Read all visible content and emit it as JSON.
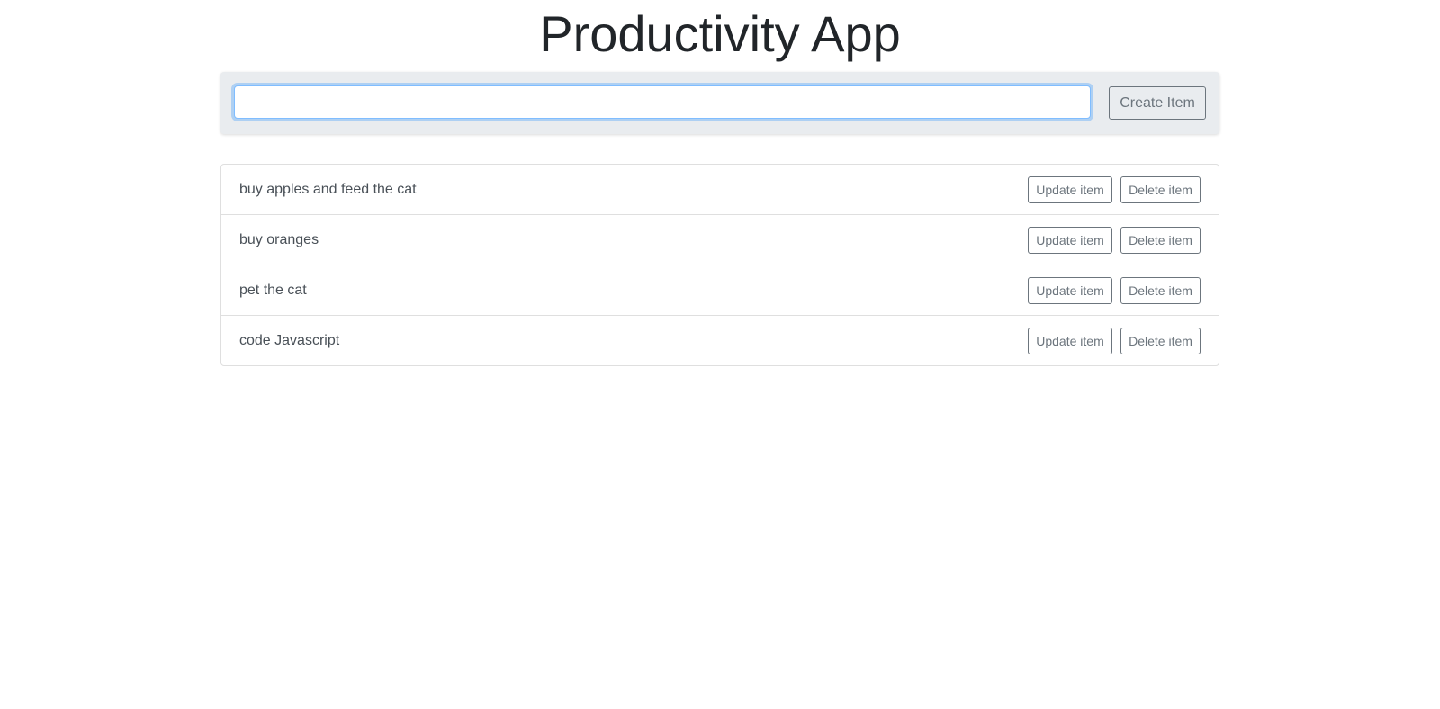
{
  "header": {
    "title": "Productivity App"
  },
  "create_form": {
    "input_value": "",
    "create_button_label": "Create Item"
  },
  "items": [
    {
      "text": "buy apples and feed the cat",
      "update_label": "Update item",
      "delete_label": "Delete item"
    },
    {
      "text": "buy oranges",
      "update_label": "Update item",
      "delete_label": "Delete item"
    },
    {
      "text": "pet the cat",
      "update_label": "Update item",
      "delete_label": "Delete item"
    },
    {
      "text": "code Javascript",
      "update_label": "Update item",
      "delete_label": "Delete item"
    }
  ],
  "colors": {
    "button_border": "#6c757d",
    "panel_background": "#e9ecef",
    "focus_border": "#80bdff"
  }
}
